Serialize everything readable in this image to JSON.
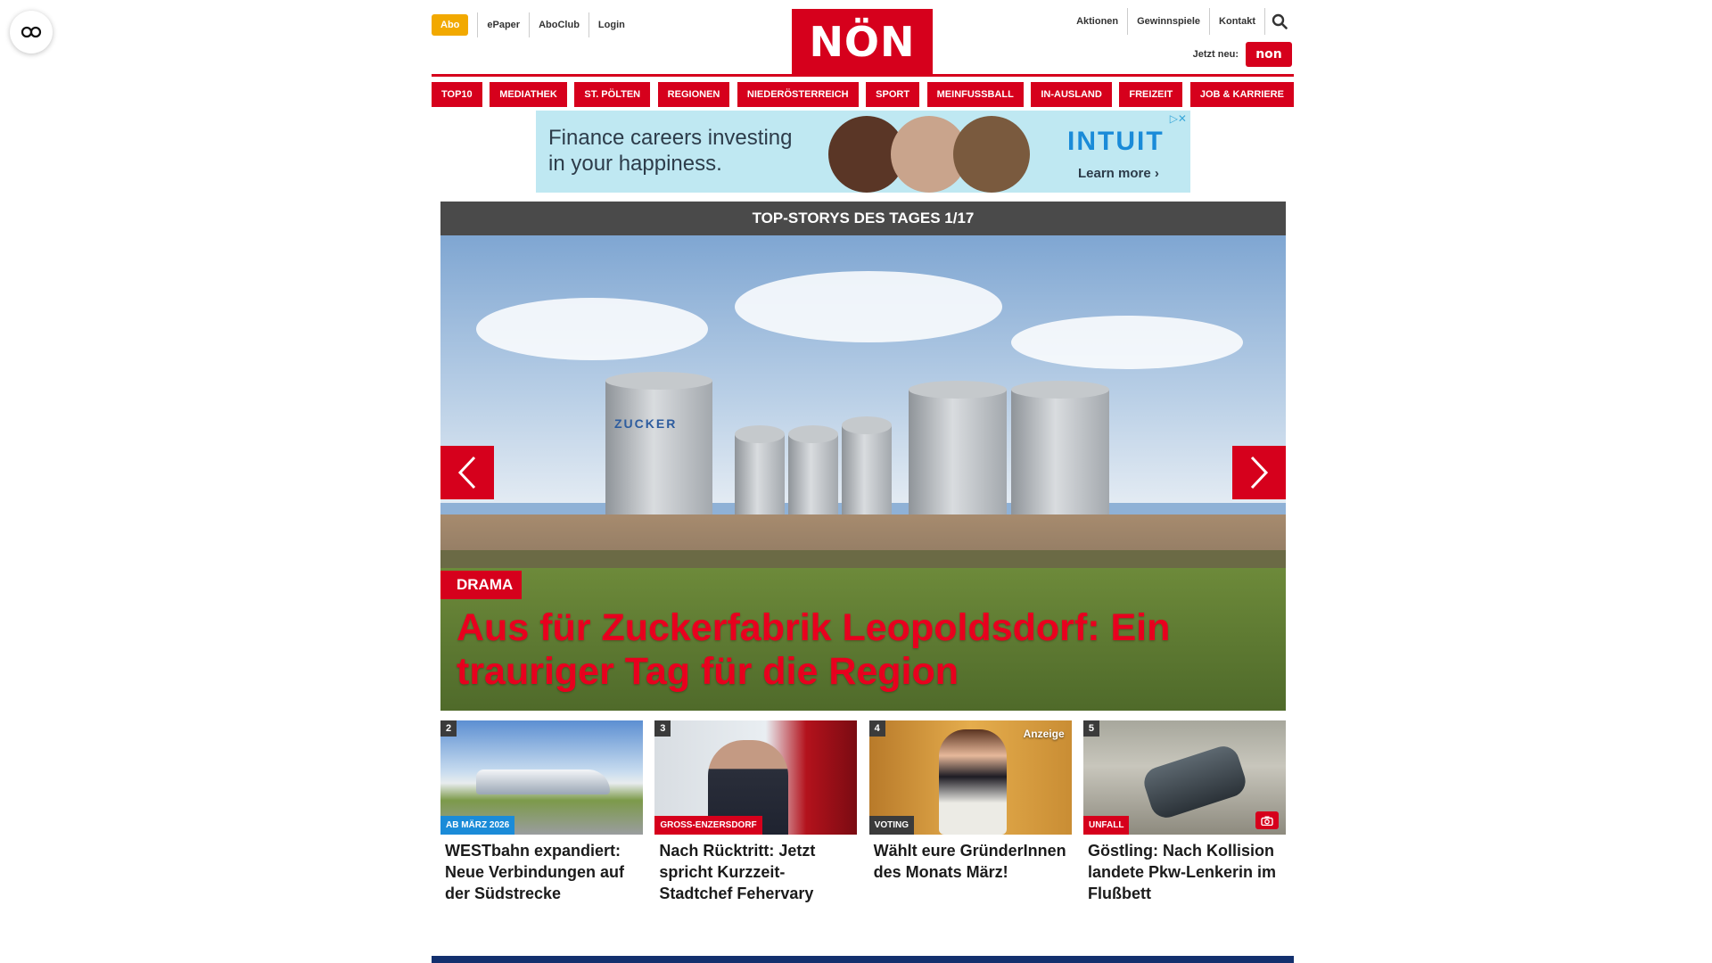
{
  "header": {
    "abo": "Abo",
    "left_links": [
      "ePaper",
      "AboClub",
      "Login"
    ],
    "logo": "NÖN",
    "right_links": [
      "Aktionen",
      "Gewinnspiele",
      "Kontakt"
    ],
    "jetzt_neu": "Jetzt neu:",
    "badge": "non"
  },
  "nav": [
    "TOP10",
    "MEDIATHEK",
    "ST. PÖLTEN",
    "REGIONEN",
    "NIEDERÖSTERREICH",
    "SPORT",
    "MEINFUSSBALL",
    "IN-AUSLAND",
    "FREIZEIT",
    "JOB & KARRIERE"
  ],
  "ad": {
    "text_line1": "Finance careers investing",
    "text_line2": "in your happiness.",
    "brand": "INTUIT",
    "cta": "Learn more ›"
  },
  "slider": {
    "heading": "TOP-STORYS DES TAGES 1/17",
    "kicker": "DRAMA",
    "headline": "Aus für Zuckerfabrik Leopoldsdorf: Ein trauriger Tag für die Region",
    "silo_label": "ZUCKER"
  },
  "cards": [
    {
      "num": "2",
      "tag": "AB MÄRZ 2026",
      "tag_color": "#1a8bd8",
      "title": "WESTbahn expandiert: Neue Verbindungen auf der Südstrecke"
    },
    {
      "num": "3",
      "tag": "GROSS-ENZERSDORF",
      "tag_color": "#d6001c",
      "title": "Nach Rücktritt: Jetzt spricht Kurzzeit-Stadtchef Fehervary"
    },
    {
      "num": "4",
      "tag": "VOTING",
      "tag_color": "#3b3b3b",
      "title": "Wählt eure GründerInnen des Monats März!",
      "badge": "Anzeige"
    },
    {
      "num": "5",
      "tag": "UNFALL",
      "tag_color": "#d6001c",
      "title": "Göstling: Nach Kollision landete Pkw-Lenkerin im Flußbett"
    }
  ],
  "colors": {
    "brand_red": "#d6001c",
    "abo_yellow": "#f2a900",
    "footer_blue": "#13306e"
  }
}
